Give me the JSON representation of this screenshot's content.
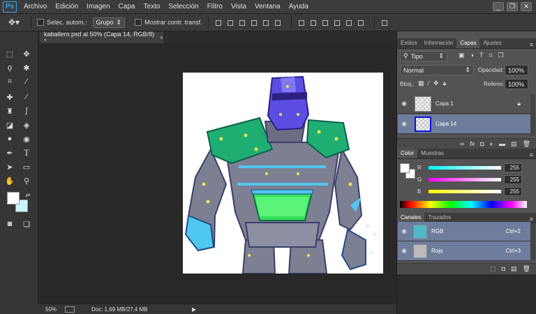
{
  "app": {
    "logo": "Ps"
  },
  "menu": [
    "Archivo",
    "Edición",
    "Imagen",
    "Capa",
    "Texto",
    "Selección",
    "Filtro",
    "Vista",
    "Ventana",
    "Ayuda"
  ],
  "window_controls": [
    "_",
    "❐",
    "✕"
  ],
  "options_bar": {
    "auto_select_label": "Selec. autom.:",
    "auto_select_value": "Grupo",
    "transform_label": "Mostrar contr. transf."
  },
  "document": {
    "tab_title": "kaballero.psd al 50% (Capa 14, RGB/8) *",
    "close": "×"
  },
  "status": {
    "zoom": "50%",
    "doc_info": "Doc: 1,69 MB/27,4 MB"
  },
  "layers_panel": {
    "tabs": [
      "Estilos",
      "Información",
      "Capas",
      "Ajustes"
    ],
    "active_tab": "Capas",
    "filter": "Tipo",
    "blend_mode": "Normal",
    "opacity_label": "Opacidad:",
    "opacity_value": "100%",
    "lock_label": "Bloq.:",
    "fill_label": "Relleno:",
    "fill_value": "100%",
    "layers": [
      {
        "name": "Capa 1",
        "selected": false
      },
      {
        "name": "Capa 14",
        "selected": true
      }
    ]
  },
  "color_panel": {
    "tabs": [
      "Color",
      "Muestras"
    ],
    "active_tab": "Color",
    "channels": [
      {
        "label": "R",
        "value": "255"
      },
      {
        "label": "G",
        "value": "255"
      },
      {
        "label": "B",
        "value": "255"
      }
    ]
  },
  "channels_panel": {
    "tabs": [
      "Canales",
      "Trazados"
    ],
    "active_tab": "Canales",
    "channels": [
      {
        "name": "RGB",
        "shortcut": "Ctrl+2"
      },
      {
        "name": "Rojo",
        "shortcut": "Ctrl+3"
      }
    ]
  },
  "colors": {
    "accent": "#31a8ff",
    "selected_layer": "#6e7d9c",
    "foreground": "#ffffff",
    "background": "#c8f4fa"
  }
}
